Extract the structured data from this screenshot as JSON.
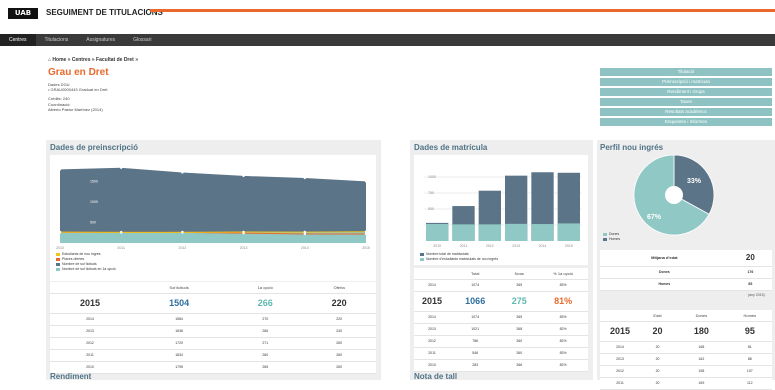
{
  "header": {
    "logo": "UAB",
    "title": "SEGUIMENT DE TITULACIONS"
  },
  "nav": {
    "items": [
      "Centres",
      "Titulacions",
      "Assignatures",
      "Glossari"
    ]
  },
  "breadcrumb": "⌂ Home » Centres » Facultat de Dret »",
  "title": "Grau en Dret",
  "info": {
    "l1": "Dades DGU",
    "l2": "• GRAU0000443 Graduat en Dret",
    "l3": "Crèdits: 240",
    "l4": "Coordinació:",
    "l5": "Alberto Pastor Martínez (2014)"
  },
  "buttons": [
    "Titulació",
    "Preinscripció i matrícula",
    "Rendiment i Grups",
    "Taxes",
    "Resultats acadèmics",
    "Enquestes i Informes"
  ],
  "pre": {
    "title": "Dades de preinscripció",
    "xticks": [
      "2010",
      "2011",
      "2012",
      "2013",
      "2014",
      "2015"
    ],
    "yticks": [
      "1500",
      "1000",
      "500"
    ],
    "legend": [
      "Estudiants de nou ingrés",
      "Places ofertes",
      "Nombre de sol·licituds",
      "Nombre de sol·licituds en 1a opció"
    ],
    "headers": [
      "Sol·licituds",
      "1a opció",
      "Oferta"
    ],
    "main": {
      "year": "2015",
      "a": "1504",
      "b": "266",
      "c": "220"
    },
    "rows": [
      [
        "2014",
        "1584",
        "270",
        "220"
      ],
      [
        "2013",
        "1636",
        "266",
        "240"
      ],
      [
        "2012",
        "1720",
        "271",
        "260"
      ],
      [
        "2011",
        "1834",
        "260",
        "260"
      ],
      [
        "2010",
        "1795",
        "265",
        "260"
      ]
    ]
  },
  "mat": {
    "title": "Dades de matrícula",
    "xticks": [
      "2010",
      "2011",
      "2012",
      "2013",
      "2014",
      "2015"
    ],
    "yticks": [
      "1000",
      "750",
      "500",
      "250"
    ],
    "legend": [
      "Nombre total de matriculats",
      "Nombre d'estudiants matriculats de nou ingrés"
    ],
    "headers": [
      "Total",
      "Nous",
      "% 1a opció"
    ],
    "main": {
      "year": "2015",
      "a": "1066",
      "b": "275",
      "c": "81%"
    },
    "rows": [
      [
        "2014",
        "1074",
        "265",
        "83%"
      ],
      [
        "2013",
        "1021",
        "268",
        "82%"
      ],
      [
        "2012",
        "786",
        "260",
        "82%"
      ],
      [
        "2011",
        "546",
        "260",
        "83%"
      ],
      [
        "2010",
        "283",
        "266",
        "82%"
      ]
    ]
  },
  "perfil": {
    "title": "Perfil nou ingrés",
    "pct1": "33%",
    "pct2": "67%",
    "legend": [
      "Dones",
      "Homes"
    ],
    "rows1": [
      [
        "Mitjana d'edat",
        "20"
      ],
      [
        "Dones",
        "176"
      ],
      [
        "Homes",
        "85"
      ]
    ],
    "note": "(any 2015)",
    "headers": [
      "Edat",
      "Dones",
      "Homes"
    ],
    "main": {
      "year": "2015",
      "a": "20",
      "b": "180",
      "c": "95"
    },
    "rows": [
      [
        "2014",
        "20",
        "168",
        "81"
      ],
      [
        "2013",
        "20",
        "162",
        "88"
      ],
      [
        "2012",
        "20",
        "158",
        "107"
      ],
      [
        "2011",
        "20",
        "169",
        "112"
      ]
    ]
  },
  "rend": {
    "title": "Rendiment"
  },
  "nota": {
    "title": "Nota de tall"
  },
  "chart_data": [
    {
      "type": "area",
      "title": "Dades de preinscripció",
      "categories": [
        "2010",
        "2011",
        "2012",
        "2013",
        "2014",
        "2015"
      ],
      "series": [
        {
          "name": "Nombre de sol·licituds",
          "values": [
            1795,
            1834,
            1720,
            1636,
            1584,
            1504
          ]
        },
        {
          "name": "Nombre de sol·licituds en 1a opció",
          "values": [
            265,
            260,
            271,
            266,
            270,
            266
          ]
        },
        {
          "name": "Places ofertes",
          "values": [
            260,
            260,
            260,
            240,
            220,
            220
          ]
        },
        {
          "name": "Estudiants de nou ingrés",
          "values": [
            266,
            260,
            260,
            268,
            265,
            275
          ]
        }
      ],
      "ylim": [
        0,
        2000
      ]
    },
    {
      "type": "bar",
      "title": "Dades de matrícula",
      "categories": [
        "2010",
        "2011",
        "2012",
        "2013",
        "2014",
        "2015"
      ],
      "series": [
        {
          "name": "Nombre total de matriculats",
          "values": [
            283,
            546,
            786,
            1021,
            1074,
            1066
          ]
        },
        {
          "name": "Nombre d'estudiants matriculats de nou ingrés",
          "values": [
            266,
            260,
            260,
            268,
            265,
            275
          ]
        }
      ],
      "ylim": [
        0,
        1250
      ]
    },
    {
      "type": "pie",
      "title": "Perfil nou ingrés",
      "categories": [
        "Dones",
        "Homes"
      ],
      "values": [
        67,
        33
      ]
    }
  ]
}
